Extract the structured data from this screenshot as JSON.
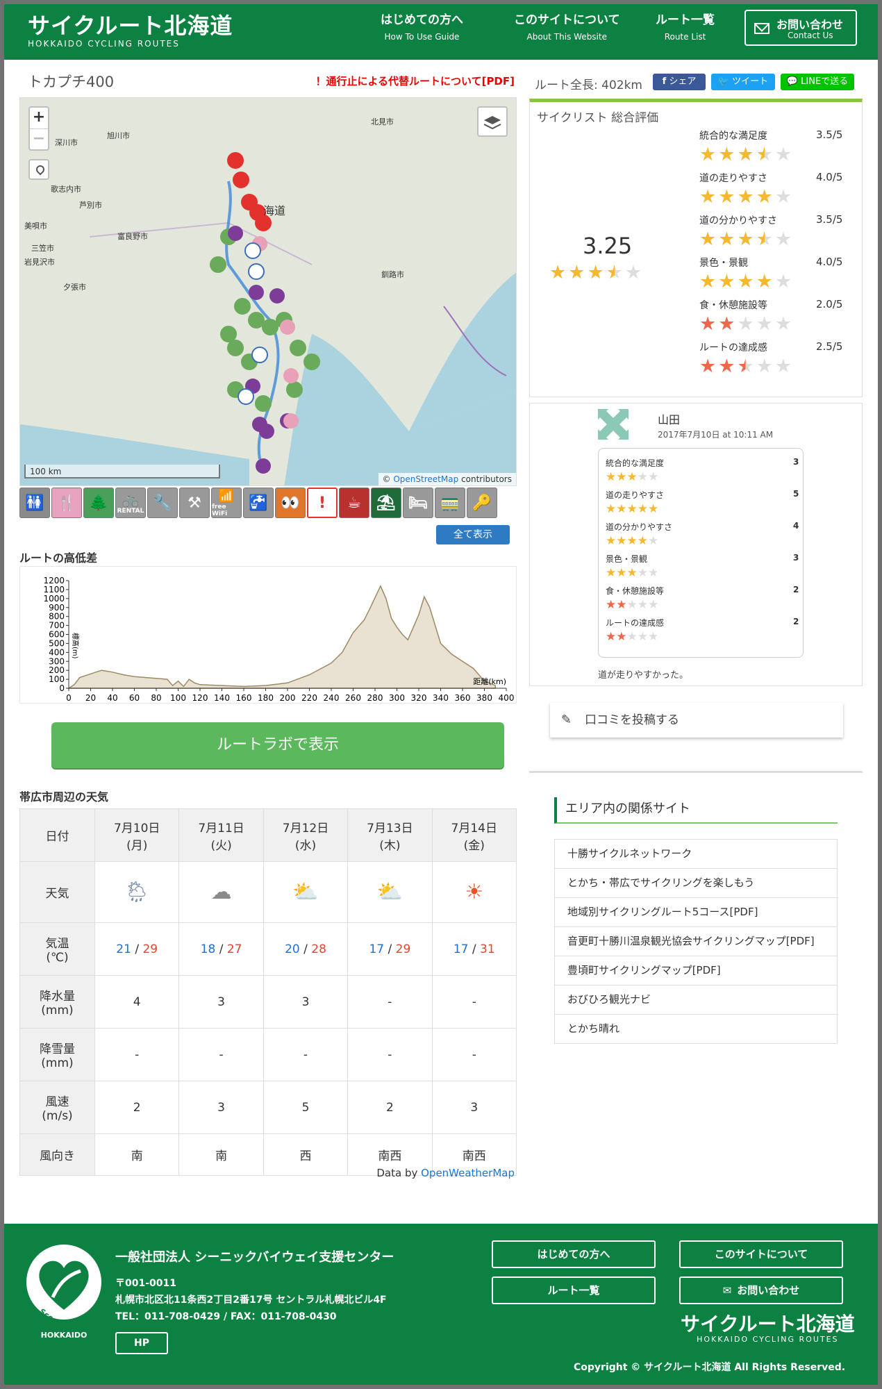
{
  "header": {
    "logo_jp": "サイクルート北海道",
    "logo_en": "HOKKAIDO CYCLING ROUTES",
    "nav": [
      {
        "label": "はじめての方へ",
        "sub": "How To Use Guide"
      },
      {
        "label": "このサイトについて",
        "sub": "About This Website"
      },
      {
        "label": "ルート一覧",
        "sub": "Route List"
      }
    ],
    "contact": {
      "label": "お問い合わせ",
      "sub": "Contact Us"
    }
  },
  "route": {
    "title": "トカプチ400",
    "alert": "！通行止による代替ルートについて[PDF]",
    "length": "ルート全長: 402km"
  },
  "share": {
    "facebook": "シェア",
    "twitter": "ツイート",
    "line": "LINEで送る"
  },
  "map": {
    "zoom_in": "+",
    "zoom_out": "−",
    "scale": "100 km",
    "attribution_prefix": "© ",
    "attribution_link": "OpenStreetMap",
    "attribution_suffix": " contributors",
    "places": [
      "北見市",
      "深川市",
      "旭川市",
      "芦別市",
      "歌志内市",
      "美唄市",
      "富良野市",
      "三笠市",
      "岩見沢市",
      "夕張市",
      "釧路市",
      "海道"
    ],
    "show_all": "全て表示",
    "filter_icons": [
      "toilet-icon",
      "restaurant-icon",
      "park-icon",
      "rental-bicycle-icon",
      "repair-icon",
      "pump-icon",
      "free-wifi-icon",
      "water-icon",
      "viewpoint-icon",
      "caution-icon",
      "cafe-icon",
      "rest-area-icon",
      "hotel-icon",
      "station-icon",
      "bike-rack-icon"
    ],
    "filter_labels": [
      "RENTAL",
      "free WiFi"
    ]
  },
  "elevation": {
    "heading": "ルートの高低差",
    "chart_data": {
      "type": "area",
      "ylabel": "標高(m)",
      "xlabel": "距離(km)",
      "xlim": [
        0,
        400
      ],
      "ylim": [
        0,
        1200
      ],
      "x_ticks": [
        0,
        20,
        40,
        60,
        80,
        100,
        120,
        140,
        160,
        180,
        200,
        220,
        240,
        260,
        280,
        300,
        320,
        340,
        360,
        380,
        400
      ],
      "y_ticks": [
        0,
        100,
        200,
        300,
        400,
        500,
        600,
        700,
        800,
        900,
        1000,
        1100,
        1200
      ],
      "x": [
        0,
        5,
        10,
        20,
        30,
        40,
        50,
        60,
        70,
        80,
        90,
        95,
        100,
        105,
        110,
        115,
        120,
        140,
        160,
        180,
        200,
        220,
        240,
        250,
        260,
        270,
        275,
        280,
        285,
        290,
        295,
        300,
        305,
        310,
        320,
        325,
        330,
        335,
        340,
        350,
        360,
        370,
        380,
        390
      ],
      "y": [
        0,
        40,
        120,
        160,
        200,
        180,
        150,
        130,
        120,
        110,
        100,
        30,
        80,
        20,
        100,
        60,
        40,
        30,
        20,
        30,
        60,
        150,
        280,
        400,
        620,
        760,
        880,
        1010,
        1140,
        1000,
        780,
        680,
        600,
        540,
        820,
        1020,
        900,
        700,
        500,
        380,
        300,
        220,
        80,
        30
      ]
    }
  },
  "ratelab_button": "ルートラボで表示",
  "weather": {
    "heading": "帯広市周辺の天気",
    "row_labels": {
      "date": "日付",
      "weather": "天気",
      "temp_l1": "気温",
      "temp_l2": "(℃)",
      "rain_l1": "降水量",
      "rain_l2": "(mm)",
      "snow_l1": "降雪量",
      "snow_l2": "(mm)",
      "wind_l1": "風速",
      "wind_l2": "(m/s)",
      "dir": "風向き"
    },
    "days": [
      {
        "date": "7月10日",
        "dow": "(月)",
        "icon": "rain-sun-icon",
        "glyph": "🌦",
        "low": "21",
        "high": "29",
        "rain": "4",
        "snow": "-",
        "wind": "2",
        "dir": "南"
      },
      {
        "date": "7月11日",
        "dow": "(火)",
        "icon": "cloud-icon",
        "glyph": "☁",
        "low": "18",
        "high": "27",
        "rain": "3",
        "snow": "-",
        "wind": "3",
        "dir": "南"
      },
      {
        "date": "7月12日",
        "dow": "(水)",
        "icon": "cloud-sun-icon",
        "glyph": "⛅",
        "low": "20",
        "high": "28",
        "rain": "3",
        "snow": "-",
        "wind": "5",
        "dir": "西"
      },
      {
        "date": "7月13日",
        "dow": "(木)",
        "icon": "cloud-sun-icon",
        "glyph": "⛅",
        "low": "17",
        "high": "29",
        "rain": "-",
        "snow": "-",
        "wind": "2",
        "dir": "南西"
      },
      {
        "date": "7月14日",
        "dow": "(金)",
        "icon": "sun-icon",
        "glyph": "☀",
        "low": "17",
        "high": "31",
        "rain": "-",
        "snow": "-",
        "wind": "3",
        "dir": "南西"
      }
    ],
    "separator": " / ",
    "data_by": "Data by ",
    "data_source": "OpenWeatherMap"
  },
  "evaluation": {
    "heading": "サイクリスト 総合評価",
    "overall": "3.25",
    "overall_value": 3.25,
    "categories": [
      {
        "name": "統合的な満足度",
        "score": "3.5/5",
        "value": 3.5,
        "color": "#f5b82e"
      },
      {
        "name": "道の走りやすさ",
        "score": "4.0/5",
        "value": 4.0,
        "color": "#f5b82e"
      },
      {
        "name": "道の分かりやすさ",
        "score": "3.5/5",
        "value": 3.5,
        "color": "#f5b82e"
      },
      {
        "name": "景色・景観",
        "score": "4.0/5",
        "value": 4.0,
        "color": "#f5b82e"
      },
      {
        "name": "食・休憩施設等",
        "score": "2.0/5",
        "value": 2.0,
        "color": "#f0664a"
      },
      {
        "name": "ルートの達成感",
        "score": "2.5/5",
        "value": 2.5,
        "color": "#f0664a"
      }
    ]
  },
  "review": {
    "name": "山田",
    "date": "2017年7月10日 at 10:11 AM",
    "items": [
      {
        "name": "統合的な満足度",
        "score": "3",
        "value": 3,
        "color": "#f5b82e"
      },
      {
        "name": "道の走りやすさ",
        "score": "5",
        "value": 5,
        "color": "#f5b82e"
      },
      {
        "name": "道の分かりやすさ",
        "score": "4",
        "value": 4,
        "color": "#f5b82e"
      },
      {
        "name": "景色・景観",
        "score": "3",
        "value": 3,
        "color": "#f5b82e"
      },
      {
        "name": "食・休憩施設等",
        "score": "2",
        "value": 2,
        "color": "#f0664a"
      },
      {
        "name": "ルートの達成感",
        "score": "2",
        "value": 2,
        "color": "#f0664a"
      }
    ],
    "comment": "道が走りやすかった。"
  },
  "post_button": "口コミを投稿する",
  "related": {
    "heading": "エリア内の関係サイト",
    "links": [
      "十勝サイクルネットワーク",
      "とかち・帯広でサイクリングを楽しもう",
      "地域別サイクリングルート5コース[PDF]",
      "音更町十勝川温泉観光協会サイクリングマップ[PDF]",
      "豊頃町サイクリングマップ[PDF]",
      "おびひろ観光ナビ",
      "とかち晴れ"
    ]
  },
  "footer": {
    "badge_text": "Scenic Byway",
    "badge_sub": "HOKKAIDO",
    "org": "一般社団法人 シーニックバイウェイ支援センター",
    "zip": "〒001-0011",
    "address": "札幌市北区北11条西2丁目2番17号 セントラル札幌北ビル4F",
    "tel": "TEL：011-708-0429 / FAX：011-708-0430",
    "hp": "HP",
    "buttons": [
      "はじめての方へ",
      "このサイトについて",
      "ルート一覧",
      "お問い合わせ"
    ],
    "logo_jp": "サイクルート北海道",
    "logo_en": "HOKKAIDO CYCLING ROUTES",
    "copyright": "Copyright © サイクルート北海道 All Rights Reserved."
  },
  "colors": {
    "brand_green": "#0c8142",
    "accent_green": "#5cb85c",
    "alert_red": "#ee0000",
    "facebook": "#3b5998",
    "twitter": "#1da1f2",
    "line": "#00c300"
  }
}
